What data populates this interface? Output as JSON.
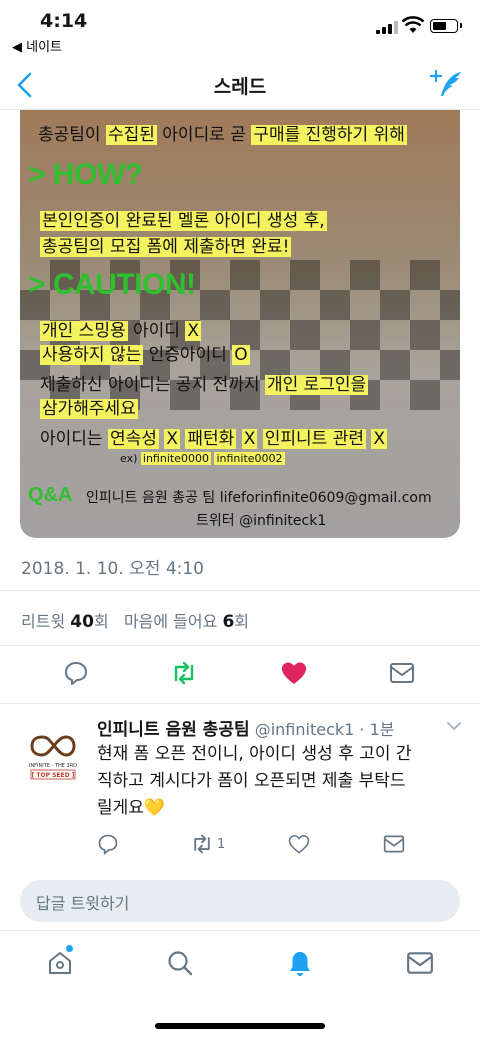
{
  "status_bar": {
    "time": "4:14",
    "back_app": "◀ 네이트"
  },
  "nav": {
    "title": "스레드"
  },
  "poster": {
    "line1": {
      "a": "총공팀이 ",
      "b": "수집된",
      "c": " 아이디로 곧 ",
      "d": "구매를 진행하기 위해"
    },
    "how": "> HOW?",
    "how_line1": "본인인증이 완료된 멜론 아이디 생성 후,",
    "how_line2": "총공팀의 모집 폼에 제출하면 완료!",
    "caution": "> CAUTION!",
    "c1": {
      "a": "개인 스밍용",
      "b": " 아이디 ",
      "c": "X"
    },
    "c2": {
      "a": "사용하지 않는",
      "b": " 인증아이디 ",
      "c": "O"
    },
    "c3": {
      "a": "제출하신 아이디는 공지 전까지 ",
      "b": "개인 로그인을"
    },
    "c4": "삼가해주세요",
    "c5": {
      "a": "아이디는 ",
      "b": "연속성",
      "c": "X",
      "d": "패턴화",
      "e": "X",
      "f": "인피니트 관련",
      "g": "X"
    },
    "example": {
      "prefix": "ex)",
      "id1": "infinite0000",
      "id2": "infinite0002"
    },
    "qa": "Q&A",
    "contact1": "인피니트 음원 총공 팀  lifeforinfinite0609@gmail.com",
    "contact2": "트위터  @infiniteck1"
  },
  "tweet": {
    "timestamp": "2018. 1. 10. 오전 4:10",
    "retweet_label": "리트윗",
    "retweet_count": "40",
    "retweet_unit": "회",
    "like_label": "마음에 들어요",
    "like_count": "6",
    "like_unit": "회"
  },
  "reply": {
    "avatar_text1": "INFINITE - THE 3RD",
    "avatar_text2": "[ TOP SEED ]",
    "name": "인피니트 음원 총공팀",
    "handle": " @infiniteck1 · 1분",
    "text": "현재 폼 오픈 전이니, 아이디 생성 후 고이 간직하고 계시다가 폼이 오픈되면 제출 부탁드릴게요💛",
    "retweet_count": "1"
  },
  "reply_box": {
    "placeholder": "답글 트윗하기"
  },
  "colors": {
    "accent": "#1da1f2",
    "retweet_green": "#17bf63",
    "like_red": "#e0245e",
    "highlight": "#f4f25e"
  }
}
